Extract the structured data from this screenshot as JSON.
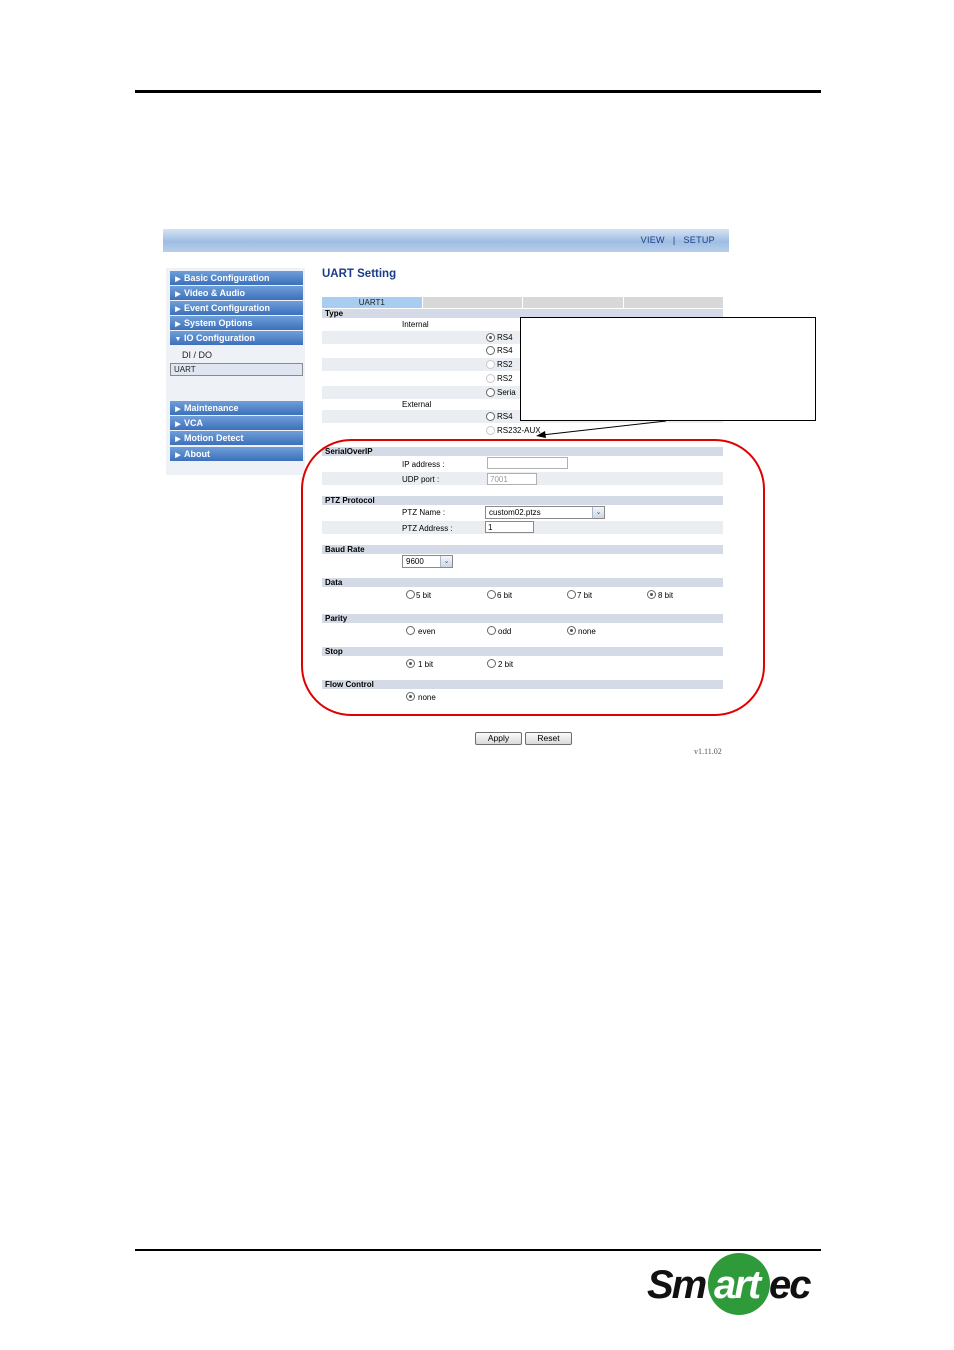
{
  "topbar": {
    "view": "VIEW",
    "separator": "|",
    "setup": "SETUP"
  },
  "sidebar": {
    "items": [
      {
        "label": "Basic Configuration",
        "arrow": "▶"
      },
      {
        "label": "Video & Audio",
        "arrow": "▶"
      },
      {
        "label": "Event Configuration",
        "arrow": "▶"
      },
      {
        "label": "System Options",
        "arrow": "▶"
      },
      {
        "label": "IO Configuration",
        "arrow": "▼"
      }
    ],
    "subitems": [
      {
        "label": "DI / DO"
      },
      {
        "label": "UART"
      }
    ],
    "items2": [
      {
        "label": "Maintenance",
        "arrow": "▶"
      },
      {
        "label": "VCA",
        "arrow": "▶"
      },
      {
        "label": "Motion Detect",
        "arrow": "▶"
      },
      {
        "label": "About",
        "arrow": "▶"
      }
    ]
  },
  "main": {
    "title": "UART Setting",
    "tabs": [
      {
        "label": "UART1"
      },
      {
        "label": ""
      },
      {
        "label": ""
      },
      {
        "label": ""
      }
    ],
    "type": {
      "header": "Type",
      "internal_label": "Internal",
      "external_label": "External",
      "internal_options": [
        "RS4",
        "RS4",
        "RS2",
        "RS2",
        "Seria"
      ],
      "external_options": [
        "RS4",
        "RS232-AUX"
      ]
    },
    "serial_over_ip": {
      "header": "SerialOverIP",
      "ip_label": "IP address :",
      "ip_value": "",
      "udp_label": "UDP port :",
      "udp_value": "7001"
    },
    "ptz": {
      "header": "PTZ Protocol",
      "name_label": "PTZ Name :",
      "name_value": "custom02.ptzs",
      "address_label": "PTZ Address :",
      "address_value": "1"
    },
    "baud": {
      "header": "Baud Rate",
      "value": "9600"
    },
    "data": {
      "header": "Data",
      "options": [
        "5 bit",
        "6 bit",
        "7 bit",
        "8 bit"
      ],
      "selected": "8 bit"
    },
    "parity": {
      "header": "Parity",
      "options": [
        "even",
        "odd",
        "none"
      ],
      "selected": "none"
    },
    "stop": {
      "header": "Stop",
      "options": [
        "1 bit",
        "2 bit"
      ],
      "selected": "1 bit"
    },
    "flow": {
      "header": "Flow Control",
      "options": [
        "none"
      ],
      "selected": "none"
    },
    "apply_label": "Apply",
    "reset_label": "Reset",
    "version": "v1.11.02"
  },
  "logo": {
    "text": "Smartec",
    "brand_color": "#2e9a3a"
  },
  "colors": {
    "annotation_red": "#e00000",
    "nav_blue": "#3c70bb"
  }
}
